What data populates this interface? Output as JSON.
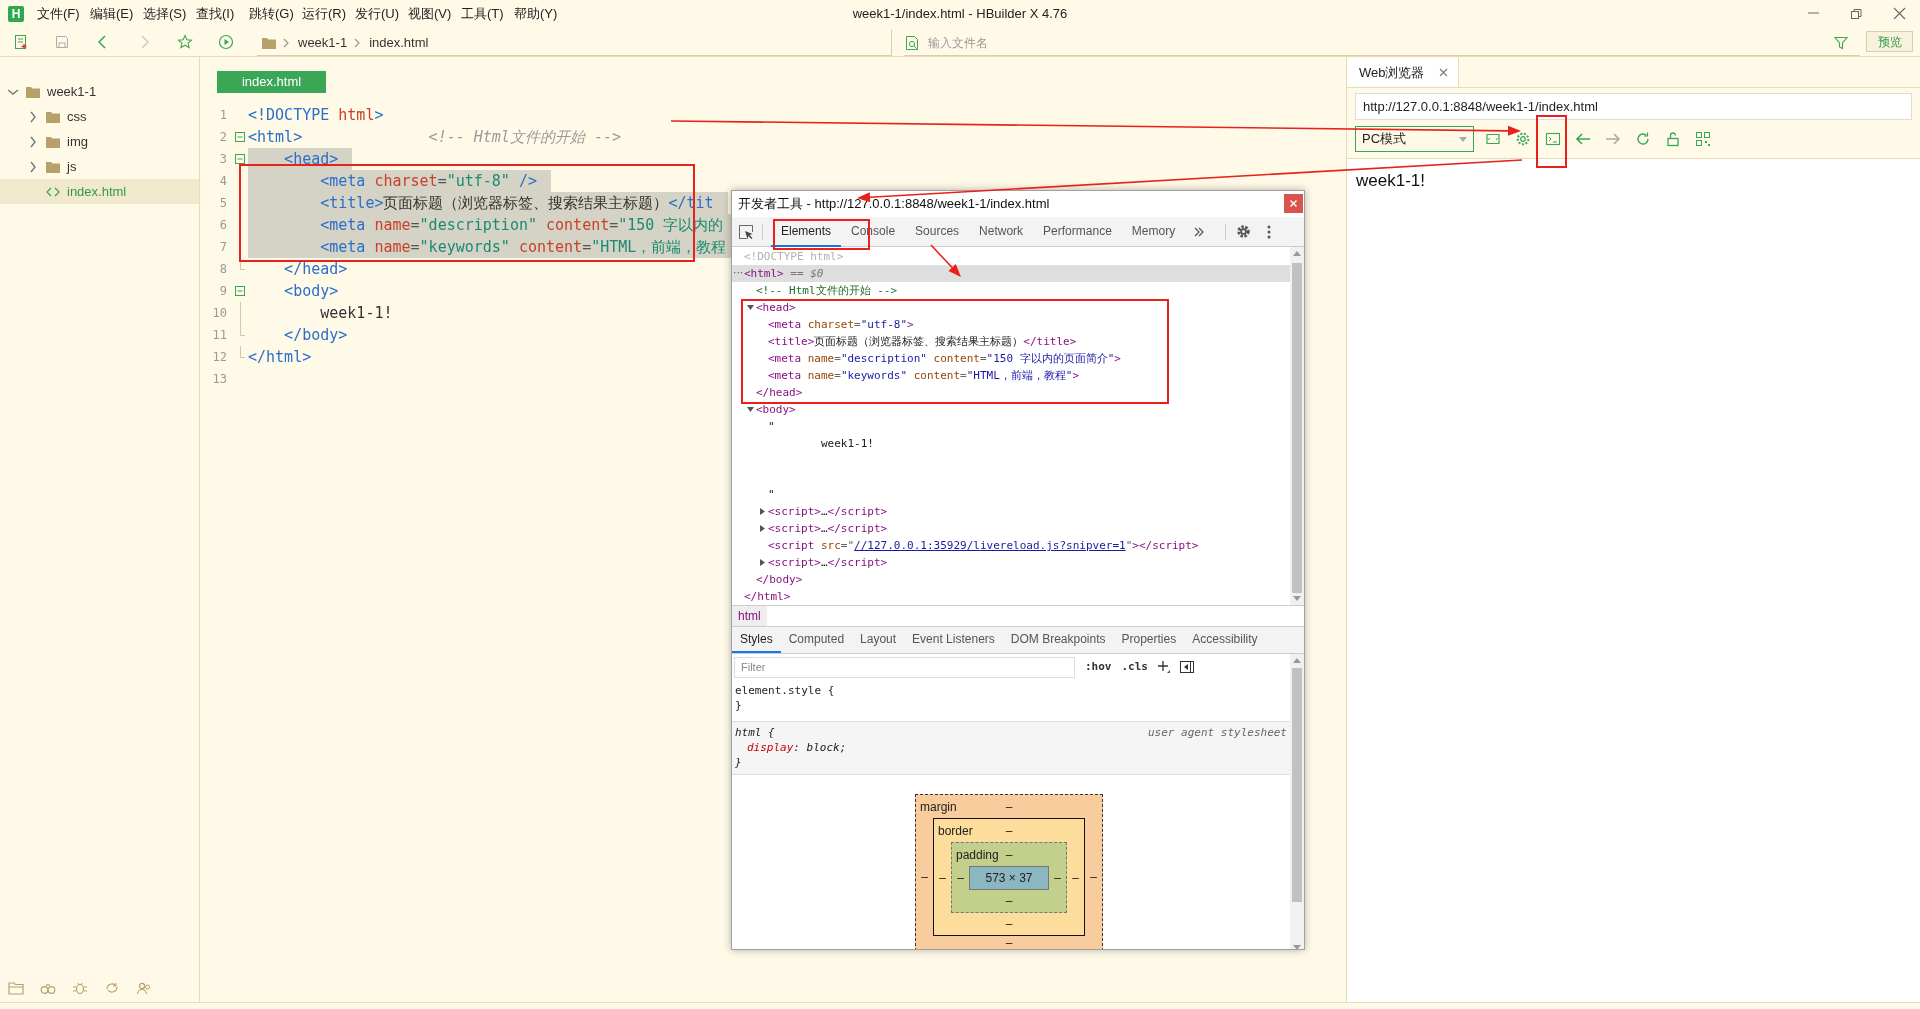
{
  "app_logo": "H",
  "menu": [
    "文件(F)",
    "编辑(E)",
    "选择(S)",
    "查找(I)",
    "跳转(G)",
    "运行(R)",
    "发行(U)",
    "视图(V)",
    "工具(T)",
    "帮助(Y)"
  ],
  "window": {
    "title": "week1-1/index.html - HBuilder X 4.76"
  },
  "toolbar": {
    "breadcrumb": [
      "week1-1",
      "index.html"
    ],
    "file_search": {
      "placeholder": "输入文件名"
    },
    "preview_button": "预览"
  },
  "sidebar": {
    "tree": [
      {
        "kind": "folder",
        "label": "week1-1",
        "expanded": true,
        "selected": false,
        "children": [
          {
            "kind": "folder",
            "label": "css",
            "expanded": false,
            "selected": false
          },
          {
            "kind": "folder",
            "label": "img",
            "expanded": false,
            "selected": false
          },
          {
            "kind": "folder",
            "label": "js",
            "expanded": false,
            "selected": false
          },
          {
            "kind": "file",
            "label": "index.html",
            "selected": true
          }
        ]
      }
    ]
  },
  "editor": {
    "tabs": [
      {
        "label": "index.html",
        "selected": true
      }
    ],
    "lines": [
      {
        "number": "1",
        "kind": "plain",
        "highlighted": false,
        "tokens": [
          {
            "kind": "tag",
            "text": "<!DOCTYPE "
          },
          {
            "kind": "attr",
            "text": "html"
          },
          {
            "kind": "tag",
            "text": ">"
          }
        ]
      },
      {
        "number": "2",
        "kind": "fold-start",
        "highlighted": false,
        "tokens": [
          {
            "kind": "tag",
            "text": "<html>"
          },
          {
            "kind": "comment",
            "text": "              <!-- Html文件的开始 -->"
          }
        ]
      },
      {
        "number": "3",
        "kind": "fold-start",
        "highlighted": true,
        "tokens": [
          {
            "kind": "tag",
            "text": "    <head>"
          }
        ]
      },
      {
        "number": "4",
        "kind": "fold-line",
        "highlighted": true,
        "tokens": [
          {
            "kind": "tag",
            "text": "        <meta "
          },
          {
            "kind": "attr",
            "text": "charset"
          },
          {
            "kind": "punct",
            "text": "="
          },
          {
            "kind": "string",
            "text": "\"utf-8\""
          },
          {
            "kind": "tag",
            "text": " />"
          }
        ]
      },
      {
        "number": "5",
        "kind": "fold-line",
        "highlighted": true,
        "tokens": [
          {
            "kind": "tag",
            "text": "        <title>"
          },
          {
            "kind": "text",
            "text": "页面标题（浏览器标签、搜索结果主标题）"
          },
          {
            "kind": "tag",
            "text": "</tit"
          }
        ]
      },
      {
        "number": "6",
        "kind": "fold-line",
        "highlighted": true,
        "tokens": [
          {
            "kind": "tag",
            "text": "        <meta "
          },
          {
            "kind": "attr",
            "text": "name"
          },
          {
            "kind": "punct",
            "text": "="
          },
          {
            "kind": "string",
            "text": "\"description\" "
          },
          {
            "kind": "attr",
            "text": "content"
          },
          {
            "kind": "punct",
            "text": "="
          },
          {
            "kind": "string",
            "text": "\"150 字以内的"
          }
        ]
      },
      {
        "number": "7",
        "kind": "fold-line",
        "highlighted": true,
        "tokens": [
          {
            "kind": "tag",
            "text": "        <meta "
          },
          {
            "kind": "attr",
            "text": "name"
          },
          {
            "kind": "punct",
            "text": "="
          },
          {
            "kind": "string",
            "text": "\"keywords\" "
          },
          {
            "kind": "attr",
            "text": "content"
          },
          {
            "kind": "punct",
            "text": "="
          },
          {
            "kind": "string",
            "text": "\"HTML，前端，教程"
          }
        ]
      },
      {
        "number": "8",
        "kind": "fold-end",
        "highlighted": false,
        "tokens": [
          {
            "kind": "tag",
            "text": "    </head>"
          }
        ]
      },
      {
        "number": "9",
        "kind": "fold-start",
        "highlighted": false,
        "tokens": [
          {
            "kind": "tag",
            "text": "    <body>"
          }
        ]
      },
      {
        "number": "10",
        "kind": "fold-line",
        "highlighted": false,
        "tokens": [
          {
            "kind": "text",
            "text": "        week1-1!"
          }
        ]
      },
      {
        "number": "11",
        "kind": "fold-end",
        "highlighted": false,
        "tokens": [
          {
            "kind": "tag",
            "text": "    </body>"
          }
        ]
      },
      {
        "number": "12",
        "kind": "fold-end",
        "highlighted": false,
        "tokens": [
          {
            "kind": "tag",
            "text": "</html>"
          }
        ]
      },
      {
        "number": "13",
        "kind": "plain",
        "highlighted": false
      }
    ]
  },
  "devtools": {
    "title": "开发者工具 - http://127.0.0.1:8848/week1-1/index.html",
    "tabs": [
      {
        "label": "Elements",
        "selected": true
      },
      {
        "label": "Console",
        "selected": false
      },
      {
        "label": "Sources",
        "selected": false
      },
      {
        "label": "Network",
        "selected": false
      },
      {
        "label": "Performance",
        "selected": false
      },
      {
        "label": "Memory",
        "selected": false
      }
    ],
    "tree": [
      {
        "selected": false,
        "tokens": [
          {
            "kind": "doctype",
            "text": "<!DOCTYPE html>"
          }
        ]
      },
      {
        "selected": true,
        "prefix": "···",
        "tokens": [
          {
            "kind": "tag",
            "text": "<html>"
          },
          {
            "kind": "marker",
            "text": " == $0"
          }
        ],
        "closing": "</html>",
        "children": [
          {
            "selected": false,
            "tokens": [
              {
                "kind": "comment",
                "text": "<!-- Html文件的开始 -->"
              }
            ]
          },
          {
            "selected": false,
            "expanded": true,
            "tokens": [
              {
                "kind": "tag",
                "text": "<head>"
              }
            ],
            "closing": "</head>",
            "children": [
              {
                "selected": false,
                "tokens": [
                  {
                    "kind": "tag",
                    "text": "<meta "
                  },
                  {
                    "kind": "attr",
                    "text": "charset"
                  },
                  {
                    "kind": "punct",
                    "text": "="
                  },
                  {
                    "kind": "value",
                    "text": "\"utf-8\""
                  },
                  {
                    "kind": "tag",
                    "text": ">"
                  }
                ]
              },
              {
                "selected": false,
                "tokens": [
                  {
                    "kind": "tag",
                    "text": "<title>"
                  },
                  {
                    "kind": "text",
                    "text": "页面标题（浏览器标签、搜索结果主标题）"
                  },
                  {
                    "kind": "tag",
                    "text": "</title>"
                  }
                ]
              },
              {
                "selected": false,
                "tokens": [
                  {
                    "kind": "tag",
                    "text": "<meta "
                  },
                  {
                    "kind": "attr",
                    "text": "name"
                  },
                  {
                    "kind": "punct",
                    "text": "="
                  },
                  {
                    "kind": "value",
                    "text": "\"description\" "
                  },
                  {
                    "kind": "attr",
                    "text": "content"
                  },
                  {
                    "kind": "punct",
                    "text": "="
                  },
                  {
                    "kind": "value",
                    "text": "\"150 字以内的页面简介\""
                  },
                  {
                    "kind": "tag",
                    "text": ">"
                  }
                ]
              },
              {
                "selected": false,
                "tokens": [
                  {
                    "kind": "tag",
                    "text": "<meta "
                  },
                  {
                    "kind": "attr",
                    "text": "name"
                  },
                  {
                    "kind": "punct",
                    "text": "="
                  },
                  {
                    "kind": "value",
                    "text": "\"keywords\" "
                  },
                  {
                    "kind": "attr",
                    "text": "content"
                  },
                  {
                    "kind": "punct",
                    "text": "="
                  },
                  {
                    "kind": "value",
                    "text": "\"HTML，前端，教程\""
                  },
                  {
                    "kind": "tag",
                    "text": ">"
                  }
                ]
              }
            ]
          },
          {
            "selected": false,
            "expanded": true,
            "tokens": [
              {
                "kind": "tag",
                "text": "<body>"
              }
            ],
            "closing": "</body>",
            "children": [
              {
                "selected": false,
                "text": "\"\n        week1-1!\n\n\n\""
              },
              {
                "selected": false,
                "expanded": false,
                "tokens": [
                  {
                    "kind": "tag",
                    "text": "<script>"
                  },
                  {
                    "kind": "text",
                    "text": "…"
                  },
                  {
                    "kind": "tag",
                    "text": "</script>"
                  }
                ]
              },
              {
                "selected": false,
                "expanded": false,
                "tokens": [
                  {
                    "kind": "tag",
                    "text": "<script>"
                  },
                  {
                    "kind": "text",
                    "text": "…"
                  },
                  {
                    "kind": "tag",
                    "text": "</script>"
                  }
                ]
              },
              {
                "selected": false,
                "tokens": [
                  {
                    "kind": "tag",
                    "text": "<script "
                  },
                  {
                    "kind": "attr",
                    "text": "src"
                  },
                  {
                    "kind": "punct",
                    "text": "=\""
                  },
                  {
                    "kind": "link",
                    "text": "//127.0.0.1:35929/livereload.js?snipver=1"
                  },
                  {
                    "kind": "punct",
                    "text": "\""
                  },
                  {
                    "kind": "tag",
                    "text": "></script>"
                  }
                ]
              },
              {
                "selected": false,
                "expanded": false,
                "tokens": [
                  {
                    "kind": "tag",
                    "text": "<script>"
                  },
                  {
                    "kind": "text",
                    "text": "…"
                  },
                  {
                    "kind": "tag",
                    "text": "</script>"
                  }
                ]
              }
            ]
          }
        ]
      }
    ],
    "breadcrumb": [
      "html"
    ],
    "styles_tabs": [
      {
        "label": "Styles",
        "selected": true
      },
      {
        "label": "Computed",
        "selected": false
      },
      {
        "label": "Layout",
        "selected": false
      },
      {
        "label": "Event Listeners",
        "selected": false
      },
      {
        "label": "DOM Breakpoints",
        "selected": false
      },
      {
        "label": "Properties",
        "selected": false
      },
      {
        "label": "Accessibility",
        "selected": false
      }
    ],
    "filter": {
      "placeholder": "Filter"
    },
    "filter_buttons": [
      ":hov",
      ".cls"
    ],
    "rules": [
      {
        "kind": "inline",
        "selector": "element.style {",
        "close": "}"
      },
      {
        "kind": "user-agent",
        "selector": "html {",
        "origin": "user agent stylesheet",
        "declarations": [
          {
            "property": "display",
            "separator": ":",
            "value": "block;"
          }
        ],
        "close": "}"
      }
    ],
    "box_model": {
      "margin": {
        "label": "margin",
        "top": "–",
        "right": "–",
        "bottom": "–",
        "left": "–"
      },
      "border": {
        "label": "border",
        "top": "–",
        "right": "–",
        "bottom": "–",
        "left": "–"
      },
      "padding": {
        "label": "padding",
        "top": "–",
        "right": "–",
        "bottom": "–",
        "left": "–"
      },
      "content": "573 × 37"
    }
  },
  "browser": {
    "tabs": [
      {
        "label": "Web浏览器",
        "selected": true
      }
    ],
    "url": "http://127.0.0.1:8848/week1-1/index.html",
    "mode": "PC模式",
    "page_text": "week1-1!"
  }
}
